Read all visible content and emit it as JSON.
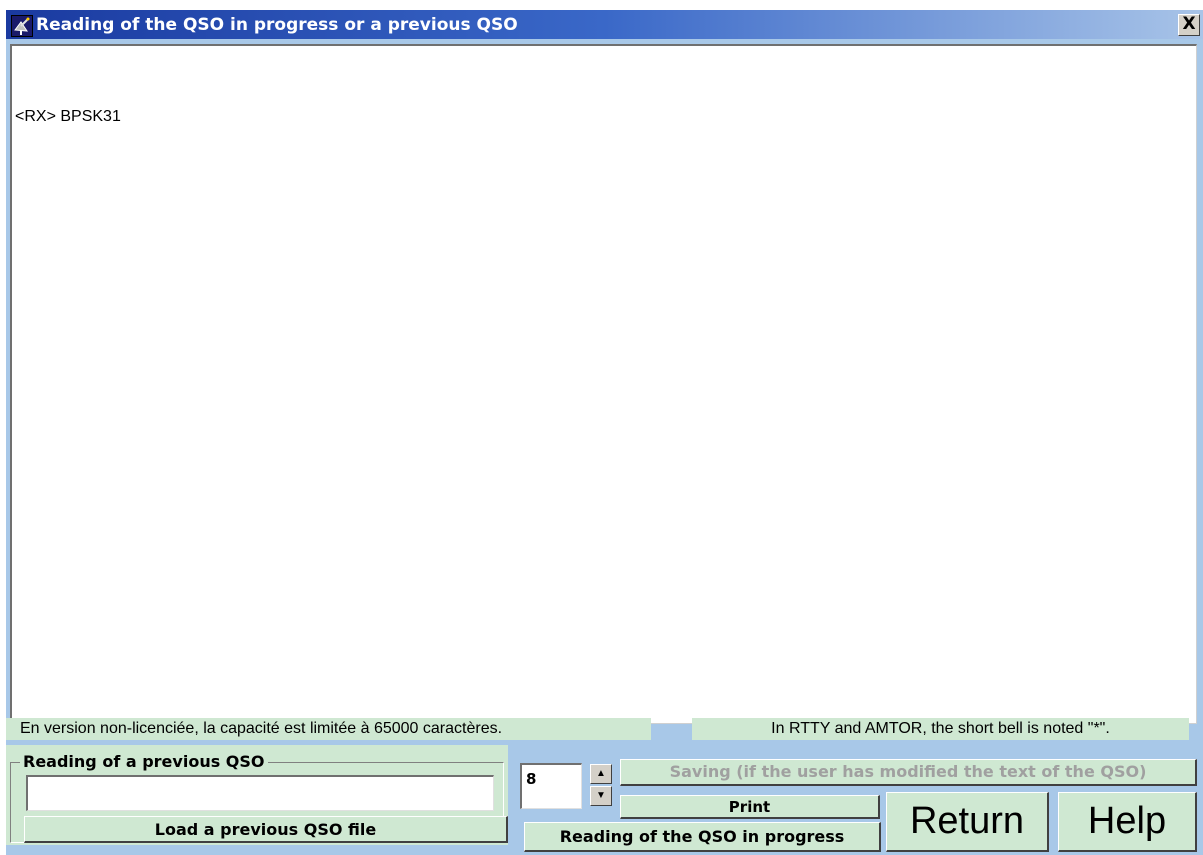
{
  "window": {
    "title": "Reading of the QSO in progress or a previous QSO",
    "close_label": "X",
    "app_icon": "satellite-dish-icon"
  },
  "qso_text": {
    "lines": [
      "<RX> BPSK31"
    ]
  },
  "status": {
    "left": "En version non-licenciée, la capacité est limitée à 65000 caractères.",
    "right": "In RTTY and AMTOR, the short bell is noted \"*\"."
  },
  "previous_qso": {
    "group_title": "Reading of a previous QSO",
    "file_value": "",
    "load_label": "Load a previous QSO file"
  },
  "font_size": {
    "value": "8",
    "up_icon": "spin-up-arrow-icon",
    "down_icon": "spin-down-arrow-icon"
  },
  "buttons": {
    "saving": "Saving (if the user has modified the text of the QSO)",
    "print": "Print",
    "in_progress": "Reading of the QSO in progress",
    "return": "Return",
    "help": "Help"
  },
  "colors": {
    "background": "#a8c8e8",
    "panel": "#cfe8d2",
    "title_start": "#1a3aa0",
    "title_end": "#a8c4e8",
    "disabled_text": "#a0a0a0"
  }
}
